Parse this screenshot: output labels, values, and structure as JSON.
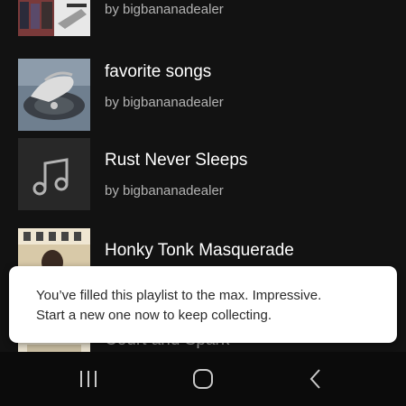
{
  "playlists": [
    {
      "title": "",
      "subtitle": "by bigbananadealer",
      "cover": "album-collage"
    },
    {
      "title": "favorite songs",
      "subtitle": "by bigbananadealer",
      "cover": "hand-record-art"
    },
    {
      "title": "Rust Never Sleeps",
      "subtitle": "by bigbananadealer",
      "cover": "music-note-icon"
    },
    {
      "title": "Honky Tonk Masquerade",
      "subtitle": "",
      "cover": "album-photo"
    },
    {
      "title": "Court and Spark",
      "subtitle": "",
      "cover": "album-photo"
    }
  ],
  "toast": {
    "line1": "You’ve filled this playlist to the max. Impressive.",
    "line2": "Start a new one now to keep collecting."
  },
  "navbar": {
    "recents": "recent-apps-icon",
    "home": "home-icon",
    "back": "back-icon"
  },
  "colors": {
    "background": "#121212",
    "subtitle": "#b3b3b3",
    "toast_bg": "#ffffff",
    "placeholder_cover": "#282828"
  }
}
